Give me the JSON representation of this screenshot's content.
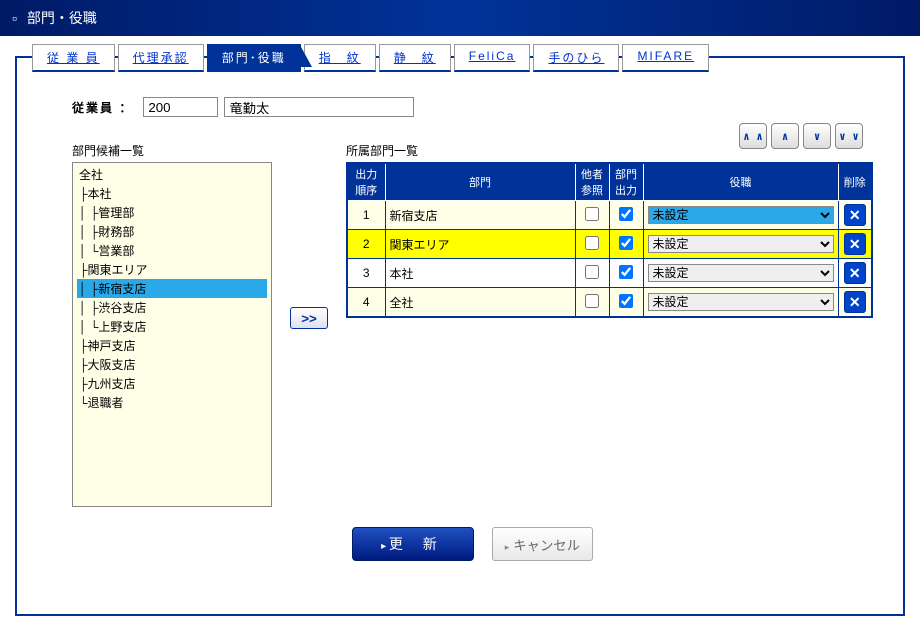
{
  "header": {
    "title": "部門・役職"
  },
  "tabs": [
    {
      "label": "従 業 員"
    },
    {
      "label": "代理承認"
    },
    {
      "label": "部門･役職"
    },
    {
      "label": "指　紋"
    },
    {
      "label": "静　紋"
    },
    {
      "label": "FeliCa"
    },
    {
      "label": "手のひら"
    },
    {
      "label": "MIFARE"
    }
  ],
  "activeTab": 2,
  "employee": {
    "label": "従業員 ：",
    "id": "200",
    "name": "竜勤太"
  },
  "orderButtons": {
    "top": "∧\n∧",
    "up": "∧",
    "down": "∨",
    "bottom": "∨\n∨"
  },
  "leftPanel": {
    "title": "部門候補一覧"
  },
  "tree": [
    {
      "text": "全社",
      "indent": 0
    },
    {
      "text": "├本社",
      "indent": 0
    },
    {
      "text": "│ ├管理部",
      "indent": 0
    },
    {
      "text": "│ ├財務部",
      "indent": 0
    },
    {
      "text": "│ └営業部",
      "indent": 0
    },
    {
      "text": "├関東エリア",
      "indent": 0
    },
    {
      "text": "│ ├新宿支店",
      "indent": 0,
      "selected": true
    },
    {
      "text": "│ ├渋谷支店",
      "indent": 0
    },
    {
      "text": "│ └上野支店",
      "indent": 0
    },
    {
      "text": "├神戸支店",
      "indent": 0
    },
    {
      "text": "├大阪支店",
      "indent": 0
    },
    {
      "text": "├九州支店",
      "indent": 0
    },
    {
      "text": "└退職者",
      "indent": 0
    }
  ],
  "addButton": ">>",
  "rightPanel": {
    "title": "所属部門一覧",
    "headers": {
      "order": "出力\n順序",
      "dept": "部門",
      "other": "他者\n参照",
      "out": "部門\n出力",
      "role": "役職",
      "del": "削除"
    }
  },
  "rows": [
    {
      "order": "1",
      "dept": "新宿支店",
      "other": false,
      "out": true,
      "role": "未設定",
      "rowClass": "row-cream",
      "selClass": "sel"
    },
    {
      "order": "2",
      "dept": "関東エリア",
      "other": false,
      "out": true,
      "role": "未設定",
      "rowClass": "row-yellow",
      "selClass": ""
    },
    {
      "order": "3",
      "dept": "本社",
      "other": false,
      "out": true,
      "role": "未設定",
      "rowClass": "row-white",
      "selClass": ""
    },
    {
      "order": "4",
      "dept": "全社",
      "other": false,
      "out": true,
      "role": "未設定",
      "rowClass": "row-cream",
      "selClass": ""
    }
  ],
  "footer": {
    "update": "更 新",
    "cancel": "キャンセル"
  }
}
